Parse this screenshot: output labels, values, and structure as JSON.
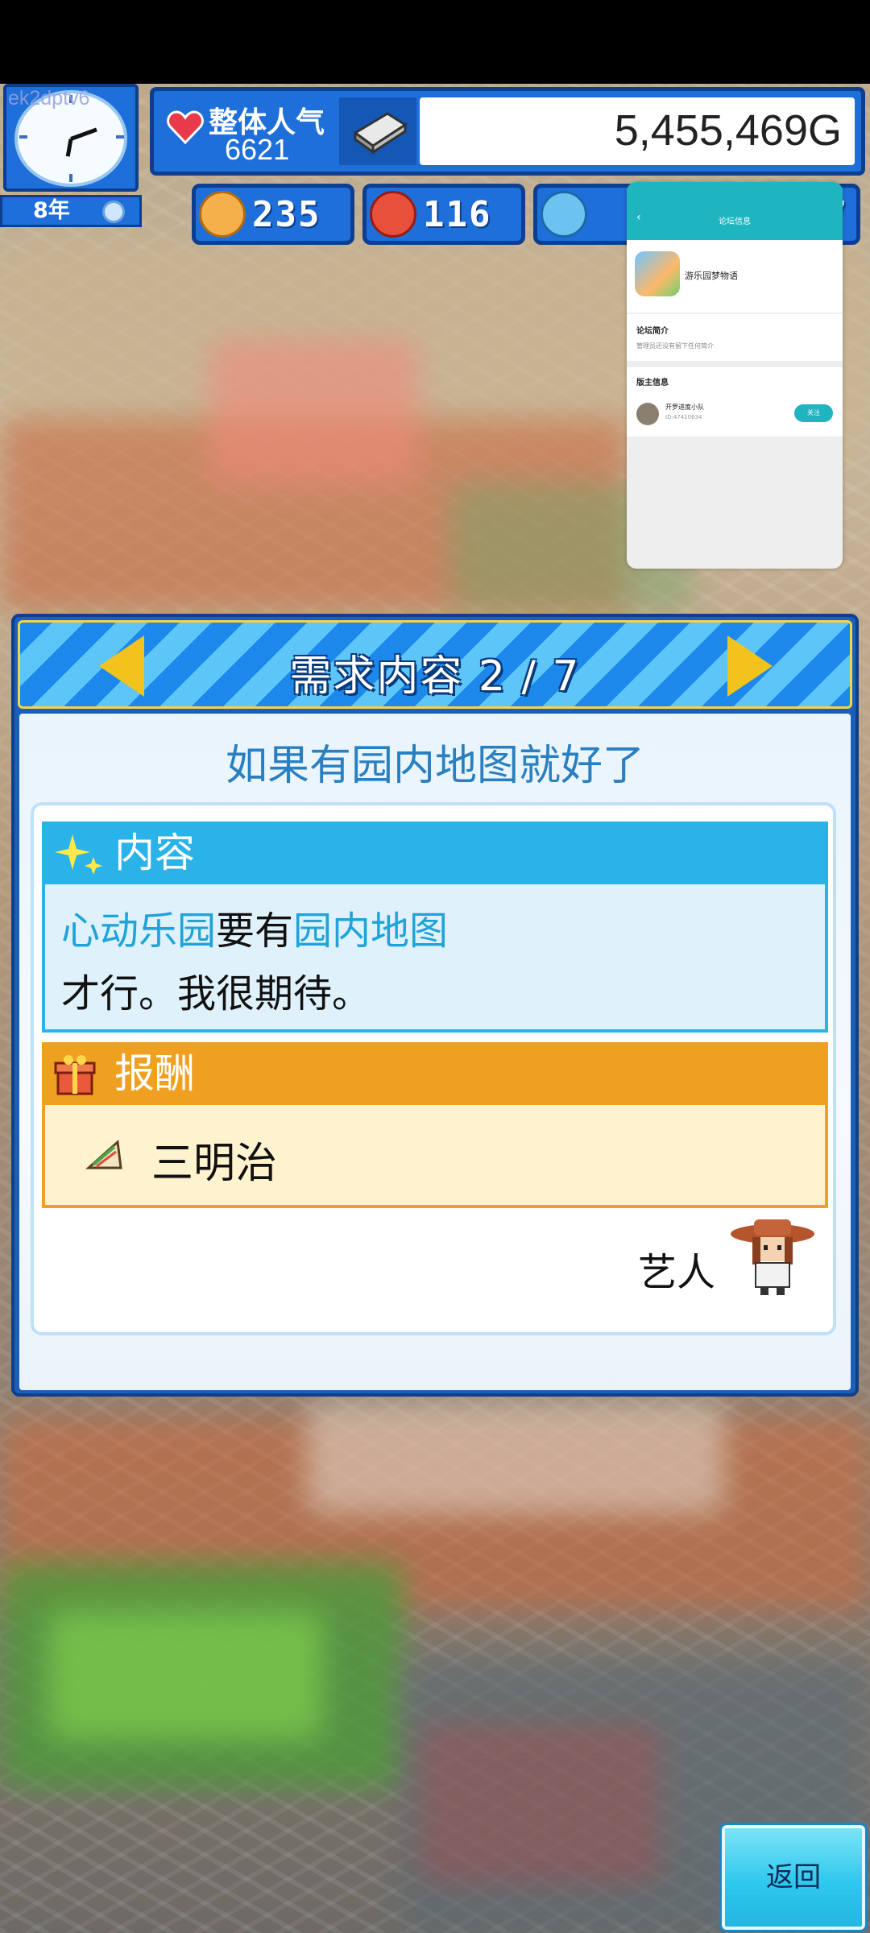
{
  "hud": {
    "uid_watermark": "ek2dptv6",
    "year": "8年",
    "popularity_label": "整体人气",
    "popularity_value": "6621",
    "money": "5,455,469G",
    "stats": [
      {
        "name": "happiness",
        "value": "235",
        "color": "#f5b04a"
      },
      {
        "name": "fire",
        "value": "116",
        "color": "#e8503c"
      },
      {
        "name": "water",
        "value": "7",
        "color": "#6cc3f0"
      }
    ]
  },
  "overlay": {
    "back": "‹",
    "title": "论坛信息",
    "app_name": "游乐园梦物语",
    "intro_title": "论坛简介",
    "intro_text": "管理员还没有留下任何简介",
    "owner_title": "版主信息",
    "owner_name": "开罗进度小队",
    "owner_id": "ID:47410634",
    "follow": "关注"
  },
  "dialog": {
    "title": "需求内容 2 / 7",
    "subtitle": "如果有园内地图就好了",
    "content_header": "内容",
    "content_park": "心动乐园",
    "content_verb": "要有",
    "content_item": "园内地图",
    "content_line2": "才行。我很期待。",
    "reward_header": "报酬",
    "reward_item": "三明治",
    "requester": "艺人"
  },
  "buttons": {
    "return": "返回"
  },
  "colors": {
    "hud_blue": "#1e6fd9",
    "content_blue": "#2ab3e8",
    "reward_orange": "#f0a020",
    "highlight_text": "#1fa3d8"
  }
}
